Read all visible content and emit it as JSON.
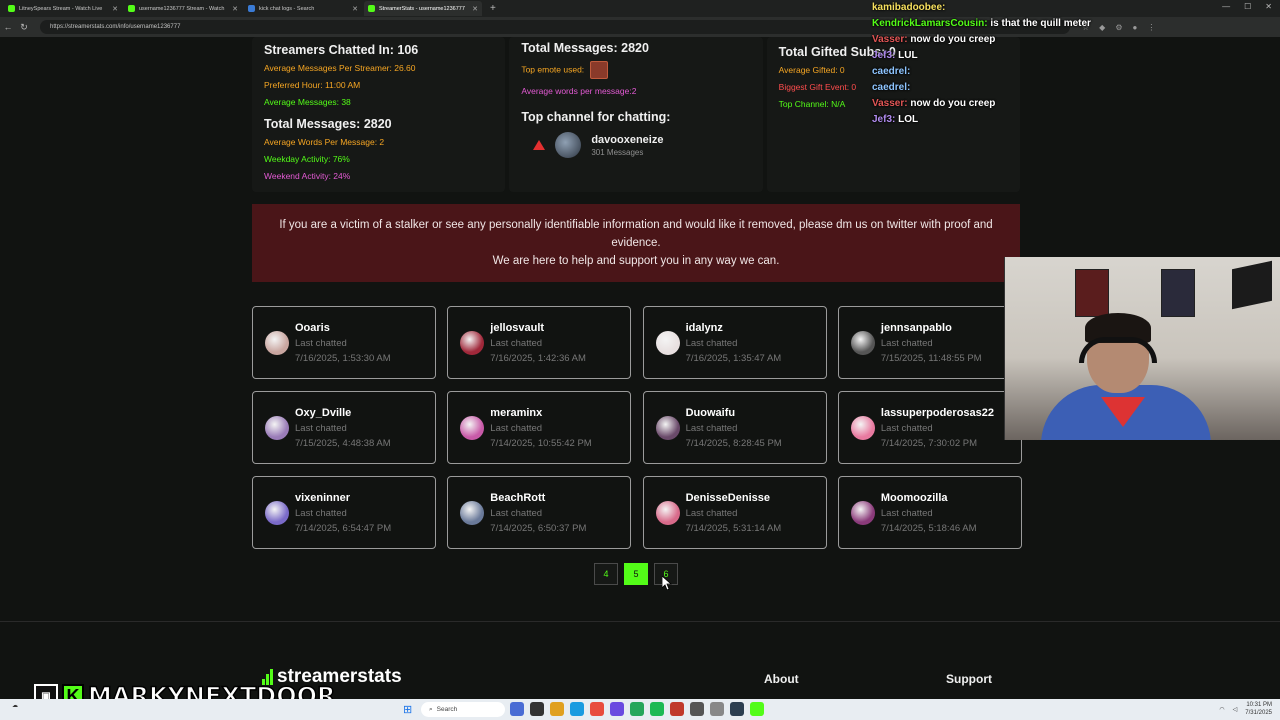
{
  "browser": {
    "tabs": [
      {
        "label": "LitneySpears Stream - Watch Live",
        "active": false,
        "color": "#53fc18"
      },
      {
        "label": "username1236777 Stream - Watch",
        "active": false,
        "color": "#53fc18"
      },
      {
        "label": "kick chat logs - Search",
        "active": false,
        "color": "#3a7bd5"
      },
      {
        "label": "StreamerStats - username1236777",
        "active": true,
        "color": "#53fc18"
      }
    ],
    "url": "https://streamerstats.com/info/username1236777"
  },
  "stats": {
    "left": {
      "title1_label": "Streamers Chatted In:",
      "title1_value": "106",
      "avg_per_streamer": "Average Messages Per Streamer: 26.60",
      "preferred_hour": "Preferred Hour: 11:00 AM",
      "avg_messages": "Average Messages: 38",
      "title2_label": "Total Messages:",
      "title2_value": "2820",
      "avg_words": "Average Words Per Message: 2",
      "weekday": "Weekday Activity: 76%",
      "weekend": "Weekend Activity: 24%"
    },
    "middle": {
      "title_label": "Total Messages:",
      "title_value": "2820",
      "top_emote": "Top emote used:",
      "avg_words": "Average words per message:2",
      "top_channel_heading": "Top channel for chatting:",
      "top_channel_name": "davooxeneize",
      "top_channel_messages": "301 Messages"
    },
    "right": {
      "title_label": "Total Gifted Subs:",
      "title_value": "0",
      "avg_gifted": "Average Gifted: 0",
      "biggest_gift": "Biggest Gift Event: 0",
      "top_channel": "Top Channel: N/A"
    }
  },
  "banner": {
    "line1": "If you are a victim of a stalker or see any personally identifiable information and would like it removed, please dm us on twitter with proof and evidence.",
    "line2": "We are here to help and support you in any way we can."
  },
  "users": [
    {
      "name": "Ooaris",
      "label": "Last chatted",
      "date": "7/16/2025, 1:53:30 AM",
      "color": "#c9a6a0"
    },
    {
      "name": "jellosvault",
      "label": "Last chatted",
      "date": "7/16/2025, 1:42:36 AM",
      "color": "#a0283a"
    },
    {
      "name": "idalynz",
      "label": "Last chatted",
      "date": "7/16/2025, 1:35:47 AM",
      "color": "#e8e0e0"
    },
    {
      "name": "jennsanpablo",
      "label": "Last chatted",
      "date": "7/15/2025, 11:48:55 PM",
      "color": "#555555"
    },
    {
      "name": "Oxy_Dville",
      "label": "Last chatted",
      "date": "7/15/2025, 4:48:38 AM",
      "color": "#9a7cb8"
    },
    {
      "name": "meraminx",
      "label": "Last chatted",
      "date": "7/14/2025, 10:55:42 PM",
      "color": "#c85aa8"
    },
    {
      "name": "Duowaifu",
      "label": "Last chatted",
      "date": "7/14/2025, 8:28:45 PM",
      "color": "#6a4a6a"
    },
    {
      "name": "lassuperpoderosas22",
      "label": "Last chatted",
      "date": "7/14/2025, 7:30:02 PM",
      "color": "#e87aa0"
    },
    {
      "name": "vixeninner",
      "label": "Last chatted",
      "date": "7/14/2025, 6:54:47 PM",
      "color": "#7a6ac8"
    },
    {
      "name": "BeachRott",
      "label": "Last chatted",
      "date": "7/14/2025, 6:50:37 PM",
      "color": "#6a7a9a"
    },
    {
      "name": "DenisseDenisse",
      "label": "Last chatted",
      "date": "7/14/2025, 5:31:14 AM",
      "color": "#d86a8a"
    },
    {
      "name": "Moomoozilla",
      "label": "Last chatted",
      "date": "7/14/2025, 5:18:46 AM",
      "color": "#8a3a7a"
    }
  ],
  "pagination": {
    "pages": [
      "4",
      "5",
      "6"
    ],
    "active": "5"
  },
  "footer": {
    "logo": "streamerstats",
    "about": "About",
    "support": "Support"
  },
  "chat": [
    {
      "user": "kamibadoobee:",
      "msg": "",
      "color": "#f6e05e"
    },
    {
      "user": "KendrickLamarsCousin:",
      "msg": "is that the quill meter",
      "color": "#53fc18"
    },
    {
      "user": "Vasser:",
      "msg": "now do you creep",
      "color": "#e35656"
    },
    {
      "user": "Jef3:",
      "msg": "LUL",
      "color": "#b18cf0"
    },
    {
      "user": "caedrel:",
      "msg": "",
      "color": "#8ec5ff"
    },
    {
      "user": "caedrel:",
      "msg": "",
      "color": "#8ec5ff"
    },
    {
      "user": "Vasser:",
      "msg": "now do you creep",
      "color": "#e35656"
    },
    {
      "user": "Jef3:",
      "msg": "LOL",
      "color": "#b18cf0"
    }
  ],
  "watermark": {
    "text": "MARKYNEXTDOOR",
    "k": "K"
  },
  "taskbar": {
    "search": "Search",
    "time": "10:31 PM",
    "date": "7/31/2025"
  }
}
